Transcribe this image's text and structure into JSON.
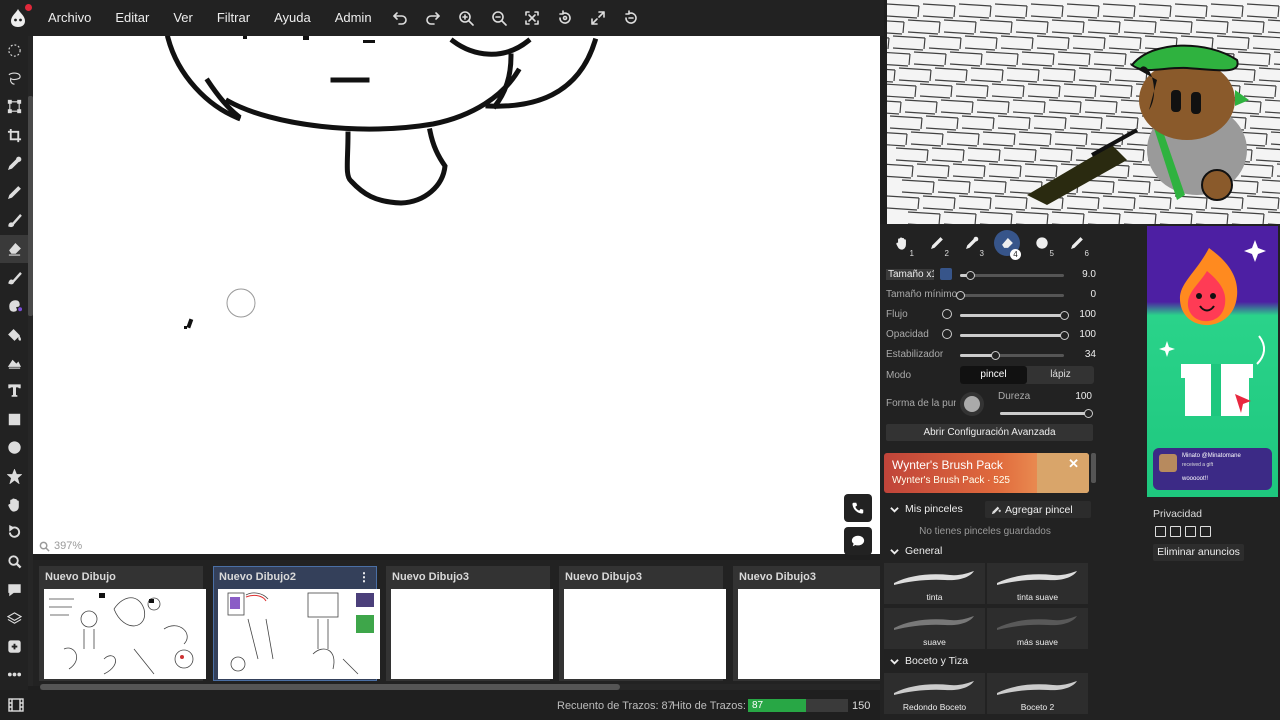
{
  "menu": {
    "items": [
      "Archivo",
      "Editar",
      "Ver",
      "Filtrar",
      "Ayuda",
      "Admin"
    ],
    "toolbar_icons": [
      "undo-icon",
      "redo-icon",
      "zoom-in-icon",
      "zoom-out-icon",
      "fit-screen-icon",
      "rotate-icon",
      "fullscreen-icon",
      "reset-icon"
    ]
  },
  "tools": [
    "lasso-select-icon",
    "transform-lasso-icon",
    "transform-icon",
    "crop-icon",
    "eyedropper-icon",
    "pen-icon",
    "brush-icon",
    "eraser-icon",
    "smudge-icon",
    "blur-icon",
    "fill-icon",
    "gradient-icon",
    "text-icon",
    "rectangle-icon",
    "ellipse-icon",
    "star-shape-icon",
    "hand-icon",
    "rotate-tool-icon",
    "zoom-tool-icon",
    "comment-icon",
    "layers-icon",
    "add-icon",
    "more-icon"
  ],
  "active_tool": "eraser-icon",
  "canvas": {
    "zoom": "397%"
  },
  "frames": [
    {
      "title": "Nuevo Dibujo",
      "selected": false
    },
    {
      "title": "Nuevo Dibujo2",
      "selected": true
    },
    {
      "title": "Nuevo Dibujo3",
      "selected": false
    },
    {
      "title": "Nuevo Dibujo3",
      "selected": false
    },
    {
      "title": "Nuevo Dibujo3",
      "selected": false
    }
  ],
  "status": {
    "stroke_count_label": "Recuento de Trazos: 87",
    "stroke_goal_label": "Hito de Trazos:",
    "goal_current": "87",
    "goal_max": "150",
    "goal_fraction": 0.58,
    "goal_color": "#28a745"
  },
  "brush_slots": [
    "1",
    "2",
    "3",
    "4",
    "5",
    "6"
  ],
  "active_slot": 3,
  "params": {
    "size": {
      "label": "Tamaño x1",
      "value": "9.0",
      "fraction": 0.1
    },
    "min_size": {
      "label": "Tamaño mínimo",
      "value": "0",
      "fraction": 0.0
    },
    "flow": {
      "label": "Flujo",
      "value": "100",
      "fraction": 1.0
    },
    "opacity": {
      "label": "Opacidad",
      "value": "100",
      "fraction": 1.0
    },
    "stabilizer": {
      "label": "Estabilizador",
      "value": "34",
      "fraction": 0.34
    },
    "mode": {
      "label": "Modo",
      "options": [
        "pincel",
        "lápiz"
      ],
      "selected": "pincel"
    },
    "shape": {
      "label": "Forma de la punta"
    },
    "hardness": {
      "label": "Dureza",
      "value": "100",
      "fraction": 1.0
    }
  },
  "advanced_button": "Abrir Configuración Avanzada",
  "promo": {
    "title": "Wynter's Brush Pack",
    "subtitle": "Wynter's Brush Pack · 525",
    "close": "✕"
  },
  "my_brushes": {
    "label": "Mis pinceles",
    "add_label": "Agregar pincel",
    "empty": "No tienes pinceles guardados"
  },
  "general": {
    "label": "General",
    "brushes": [
      "tinta",
      "tinta suave",
      "suave",
      "más suave"
    ]
  },
  "sketch": {
    "label": "Boceto y Tiza",
    "brushes": [
      "Redondo Boceto",
      "Boceto 2"
    ]
  },
  "ad": {
    "notif_name": "Minato @Minatomane",
    "notif_sub": "received a gift",
    "notif_text": "wooooot!!",
    "privacy": "Privacidad",
    "remove": "Eliminar anuncios"
  },
  "accent": "#37558a"
}
